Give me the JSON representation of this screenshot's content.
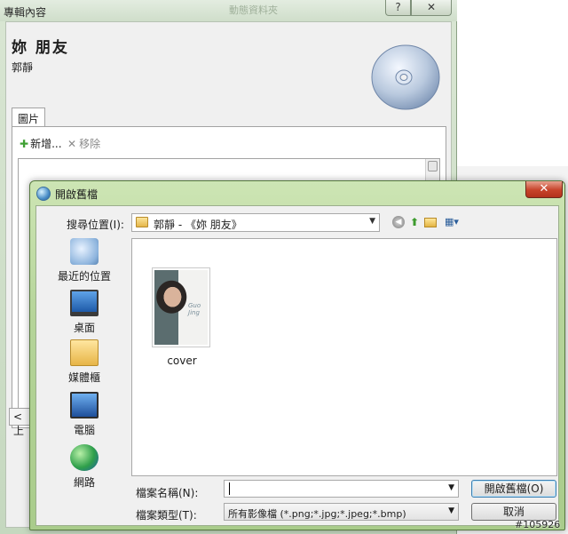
{
  "album_window": {
    "title": "專輯內容",
    "center_title": "動態資料夾",
    "help_label": "?",
    "close_label": "✕",
    "album_name": "妳  朋友",
    "artist": "郭靜",
    "tab_label": "圖片",
    "add_label": "新增...",
    "remove_label": "移除",
    "bottom_tab_label": "< 上"
  },
  "open_dialog": {
    "title": "開啟舊檔",
    "close_label": "✕",
    "look_in_label": "搜尋位置(I):",
    "look_in_value": "郭靜 - 《妳 朋友》",
    "places": [
      {
        "label": "最近的位置",
        "icon": "recent-places-icon"
      },
      {
        "label": "桌面",
        "icon": "desktop-icon"
      },
      {
        "label": "媒體櫃",
        "icon": "libraries-icon"
      },
      {
        "label": "電腦",
        "icon": "computer-icon"
      },
      {
        "label": "網路",
        "icon": "network-icon"
      }
    ],
    "files": [
      {
        "name": "cover",
        "thumb_text": "Guo Jing"
      }
    ],
    "filename_label": "檔案名稱(N):",
    "filename_value": "",
    "filetype_label": "檔案類型(T):",
    "filetype_value": "所有影像檔 (*.png;*.jpg;*.jpeg;*.bmp)",
    "open_button": "開啟舊檔(O)",
    "cancel_button": "取消"
  },
  "watermark": "#105926"
}
